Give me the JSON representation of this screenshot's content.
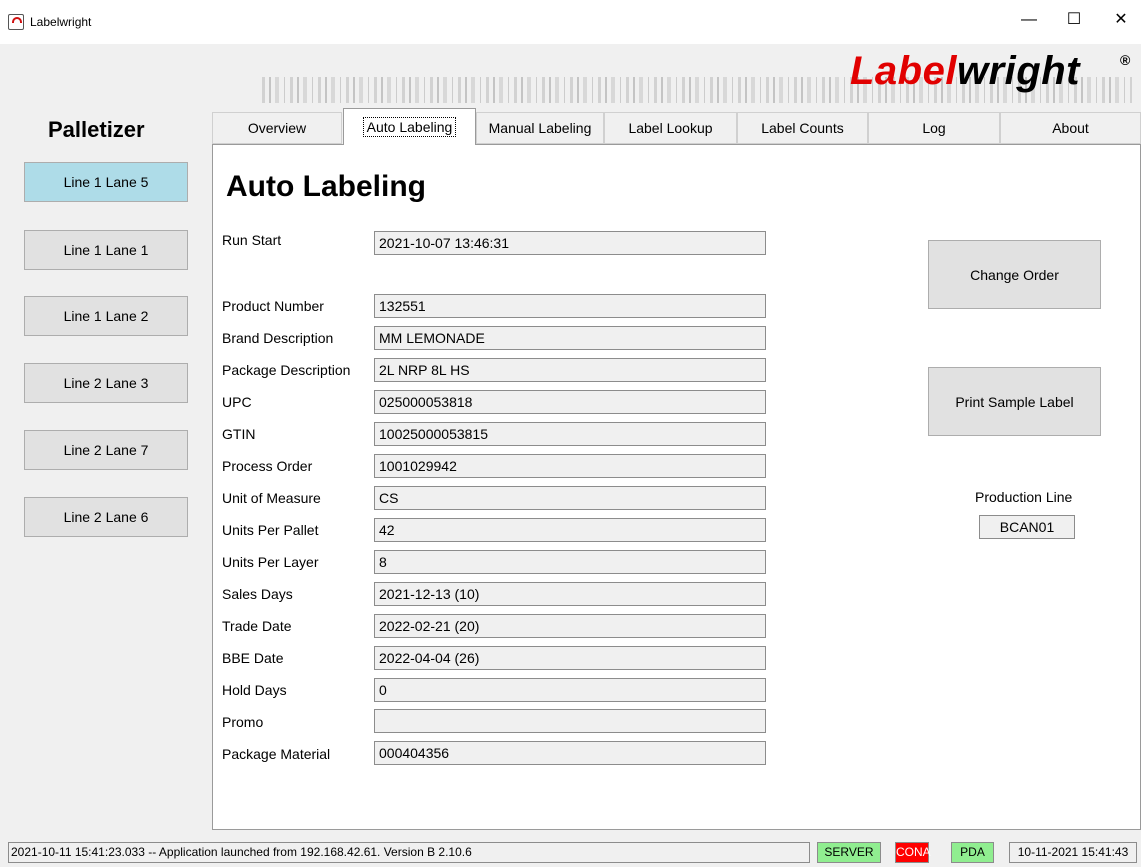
{
  "window": {
    "title": "Labelwright",
    "minimize_glyph": "—",
    "maximize_glyph": "☐",
    "close_glyph": "✕"
  },
  "brand": {
    "part1": "Label",
    "part2": "wright",
    "reg": "®"
  },
  "sidebar": {
    "title": "Palletizer",
    "lanes": [
      {
        "label": "Line 1 Lane 5",
        "active": true
      },
      {
        "label": "Line 1 Lane 1"
      },
      {
        "label": "Line 1 Lane 2"
      },
      {
        "label": "Line 2 Lane 3"
      },
      {
        "label": "Line 2 Lane 7"
      },
      {
        "label": "Line 2 Lane 6"
      }
    ]
  },
  "tabs": [
    "Overview",
    "Auto Labeling",
    "Manual Labeling",
    "Label Lookup",
    "Label Counts",
    "Log",
    "About"
  ],
  "active_tab": "Auto Labeling",
  "page": {
    "title": "Auto Labeling",
    "run_start": {
      "label": "Run Start",
      "value": "2021-10-07 13:46:31"
    },
    "fields": [
      {
        "label": "Product Number",
        "value": "132551"
      },
      {
        "label": "Brand Description",
        "value": "MM LEMONADE"
      },
      {
        "label": "Package Description",
        "value": "2L NRP 8L HS"
      },
      {
        "label": "UPC",
        "value": "025000053818"
      },
      {
        "label": "GTIN",
        "value": "10025000053815"
      },
      {
        "label": "Process Order",
        "value": "1001029942"
      },
      {
        "label": "Unit of Measure",
        "value": "CS"
      },
      {
        "label": "Units Per Pallet",
        "value": "42"
      },
      {
        "label": "Units Per Layer",
        "value": "8"
      },
      {
        "label": "Sales Days",
        "value": "2021-12-13 (10)"
      },
      {
        "label": "Trade Date",
        "value": "2022-02-21 (20)"
      },
      {
        "label": "BBE Date",
        "value": "2022-04-04 (26)"
      },
      {
        "label": "Hold Days",
        "value": "0"
      },
      {
        "label": "Promo",
        "value": ""
      },
      {
        "label": "Package Material",
        "value": "000404356"
      }
    ],
    "change_order_label": "Change Order",
    "print_sample_label": "Print Sample Label",
    "production_line_label": "Production Line",
    "production_line_value": "BCAN01"
  },
  "status": {
    "message": "2021-10-11 15:41:23.033 -- Application launched from 192.168.42.61. Version B 2.10.6",
    "server": "SERVER",
    "cona": "CONA",
    "pda": "PDA",
    "datetime": "10-11-2021 15:41:43",
    "colors": {
      "ok": "#90ee90",
      "error": "#ff0000"
    }
  },
  "colors": {
    "active_lane": "#aedce8",
    "brand_red": "#e10000"
  }
}
